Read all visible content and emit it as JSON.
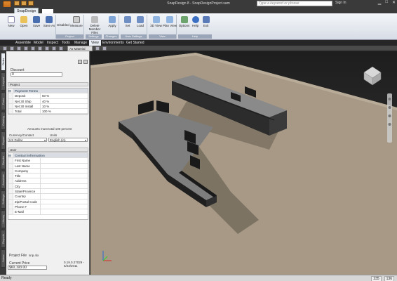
{
  "window": {
    "title": "SnapDesign 8 - SnapDesignProject.sam",
    "search_placeholder": "Type a keyword or phrase",
    "sign_in": "Sign In"
  },
  "ribbon_tab": "SnapDesign",
  "ribbon": {
    "new": "New",
    "open": "Open",
    "save": "Save",
    "save_as": "Save As",
    "disabled": "Disabled",
    "measure": "Measure",
    "delete_member_files": "Delete Member Files",
    "apply": "Apply",
    "set": "Set",
    "load": "Load",
    "view_3d": "3D View",
    "plan_view": "Plan View",
    "options": "Options",
    "help": "Help",
    "exit": "Exit",
    "cap_project": "Project",
    "cap_settings": "Settings",
    "cap_changes": "Changes",
    "cap_user_settings": "User Settings",
    "cap_view": "View",
    "cap_help": "Help"
  },
  "menu": [
    "Assemble",
    "Model",
    "Inspect",
    "Tools",
    "Manage",
    "View",
    "Environments",
    "Get Started"
  ],
  "toolbar": {
    "material": "As Material"
  },
  "vtabs": [
    "Order",
    "Layout",
    "Parts",
    "Catalog",
    "Export",
    "Render",
    "Annotate",
    "Settings",
    "Library",
    "Reports",
    "Notes"
  ],
  "panel": {
    "discount_label": "Discount",
    "discount_value": "0",
    "project_header": "Project",
    "payment_terms_header": "Payment Terms",
    "payment_rows": [
      {
        "name": "Deposit",
        "value": "50 %"
      },
      {
        "name": "Net 30 Ship",
        "value": "40 %"
      },
      {
        "name": "Net 30 Install",
        "value": "10 %"
      },
      {
        "name": "Total",
        "value": "100 %"
      }
    ],
    "amounts_note": "Amounts must total 100 percent",
    "currency_label": "Currency/Contact",
    "currency_value": "US Dollar",
    "units_label": "Units",
    "units_value": "English (in)",
    "user_header": "User",
    "contact_info_header": "Contact Information",
    "contact_fields": [
      "First Name",
      "Last Name",
      "Company",
      "Title",
      "Address",
      "City",
      "State/Province",
      "Country",
      "Zip/Postal Code",
      "Phone #",
      "E-Mail"
    ],
    "project_file_label": "Project File",
    "project_file_value": "snp.4ix",
    "current_price_label": "Current Price",
    "current_price_value": "$60,193.00",
    "date_value": "0.19.0.27029 - 5/23/2011"
  },
  "status": {
    "text": "Ready",
    "count1": "235",
    "count2": "136"
  },
  "colors": {
    "accent": "#9aa6b8",
    "viewport_floor": "#a79985",
    "desk_top": "#8a8a8a"
  }
}
